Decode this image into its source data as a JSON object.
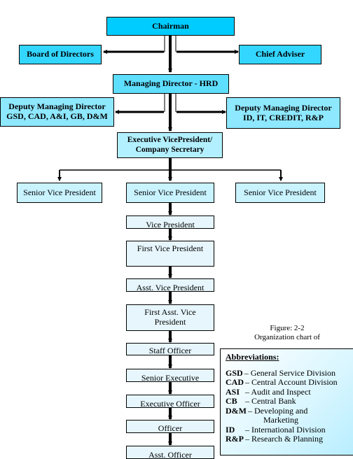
{
  "chart": {
    "chairman": "Chairman",
    "board_of_directors": "Board of Directors",
    "chief_adviser": "Chief Adviser",
    "managing_director": "Managing Director - HRD",
    "dmd_left": {
      "line1": "Deputy Managing Director",
      "line2": "GSD, CAD, A&I, GB, D&M"
    },
    "dmd_right": {
      "line1": "Deputy Managing Director",
      "line2": "ID, IT, CREDIT, R&P"
    },
    "evp": {
      "line1": "Executive VicePresident/",
      "line2": "Company Secretary"
    },
    "senior_vps": [
      "Senior Vice President",
      "Senior Vice President",
      "Senior Vice President"
    ],
    "vice_president": "Vice President",
    "first_vice_president": "First Vice President",
    "asst_vice_president": "Asst. Vice President",
    "first_asst_vice_president": {
      "line1": "First Asst. Vice",
      "line2": "President"
    },
    "staff_officer": "Staff Officer",
    "senior_executive": "Senior Executive",
    "executive_officer": "Executive Officer",
    "officer": "Officer",
    "asst_officer": "Asst. Officer"
  },
  "caption": {
    "figure": "Figure: 2-2",
    "text": "Organization chart of"
  },
  "abbreviations": {
    "title": "Abbreviations:",
    "items": [
      {
        "key": "GSD",
        "value": "– General Service Division"
      },
      {
        "key": "CAD",
        "value": "– Central Account Division"
      },
      {
        "key": "ASI",
        "value": "– Audit and Inspect"
      },
      {
        "key": "CB",
        "value": "– Central Bank"
      },
      {
        "key": "D&M",
        "value": "– Developing and",
        "cont": "Marketing"
      },
      {
        "key": "ID",
        "value": "– International Division"
      },
      {
        "key": "R&P",
        "value": "– Research & Planning"
      }
    ]
  },
  "colors": {
    "chairman": "#00ccff",
    "managing_director": "#5fdfff",
    "deputy": "#8ee8ff",
    "evp": "#b3f0ff",
    "senior_vp": "#c9f3ff",
    "lower_ranks": "#e6f6fc"
  }
}
